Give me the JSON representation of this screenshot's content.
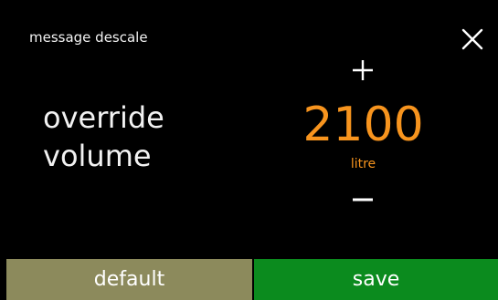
{
  "header": {
    "title": "message descale",
    "close_icon": "close-icon"
  },
  "setting": {
    "label_line1": "override",
    "label_line2": "volume",
    "value": "2100",
    "unit": "litre",
    "value_color": "#f7941e",
    "increase_icon": "plus-icon",
    "decrease_icon": "minus-icon"
  },
  "buttons": {
    "default_label": "default",
    "save_label": "save",
    "default_color": "#8c8a5c",
    "save_color": "#0b8b1e"
  }
}
